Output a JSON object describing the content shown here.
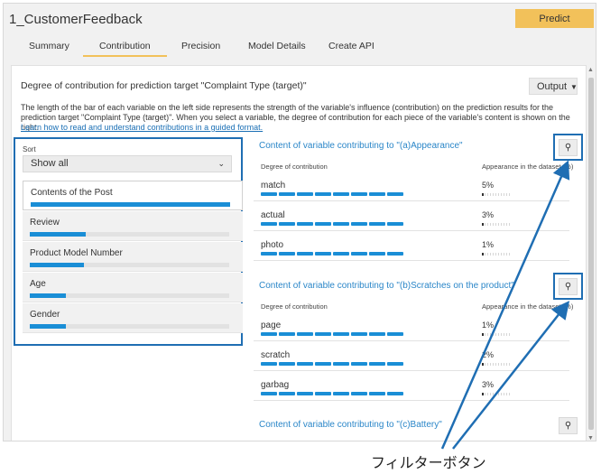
{
  "app": {
    "title": "1_CustomerFeedback",
    "predict_label": "Predict",
    "accent_color": "#f2c15a",
    "link_color": "#2a86c8",
    "bar_color": "#1a8ed6"
  },
  "tabs": [
    {
      "label": "Summary"
    },
    {
      "label": "Contribution"
    },
    {
      "label": "Precision"
    },
    {
      "label": "Model Details"
    },
    {
      "label": "Create API"
    }
  ],
  "active_tab": "Contribution",
  "main": {
    "heading": "Degree of contribution for prediction target \"Complaint Type (target)\"",
    "output_label": "Output",
    "description": "The length of the bar of each variable on the left side represents the strength of the variable's influence (contribution) on the prediction results for the prediction target \"Complaint Type (target)\". When you select a variable, the degree of contribution for each piece of the variable's content is shown on the right.",
    "learn_link": "Learn how to read and understand contributions in a guided format."
  },
  "sort": {
    "label": "Sort",
    "selected": "Show all"
  },
  "variables": [
    {
      "label": "Contents of the Post",
      "contribution": 1.0,
      "selected": true
    },
    {
      "label": "Review",
      "contribution": 0.28
    },
    {
      "label": "Product Model Number",
      "contribution": 0.27
    },
    {
      "label": "Age",
      "contribution": 0.18
    },
    {
      "label": "Gender",
      "contribution": 0.18
    }
  ],
  "sections": [
    {
      "title": "Content of variable contributing to \"(a)Appearance\"",
      "col_contribution": "Degree of contribution",
      "col_appearance": "Appearance in the dataset (%)",
      "rows": [
        {
          "label": "match",
          "segments": 8,
          "percent": "5%"
        },
        {
          "label": "actual",
          "segments": 8,
          "percent": "3%"
        },
        {
          "label": "photo",
          "segments": 8,
          "percent": "1%"
        }
      ]
    },
    {
      "title": "Content of variable contributing to \"(b)Scratches on the product\"",
      "col_contribution": "Degree of contribution",
      "col_appearance": "Appearance in the dataset (%)",
      "rows": [
        {
          "label": "page",
          "segments": 8,
          "percent": "1%"
        },
        {
          "label": "scratch",
          "segments": 8,
          "percent": "2%"
        },
        {
          "label": "garbag",
          "segments": 8,
          "percent": "3%"
        }
      ]
    },
    {
      "title": "Content of variable contributing to \"(c)Battery\"",
      "rows": []
    }
  ],
  "filter_icon": "filter-icon",
  "annotation": {
    "caption": "フィルターボタン",
    "highlight_color": "#1f6eb3"
  }
}
